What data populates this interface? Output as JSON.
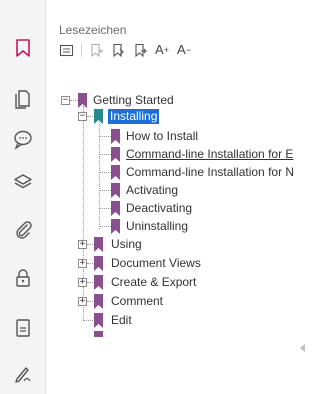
{
  "panel": {
    "title": "Lesezeichen"
  },
  "toolbar": {
    "items": [
      {
        "icon": "options-list-icon"
      },
      {
        "icon": "new-bookmark-icon"
      },
      {
        "icon": "expand-bookmark-icon"
      },
      {
        "icon": "collapse-bookmark-icon"
      }
    ],
    "text_larger": "A",
    "text_larger_sign": "+",
    "text_smaller": "A",
    "text_smaller_sign": "−"
  },
  "rail": {
    "items": [
      {
        "icon": "bookmark-icon",
        "active": true
      },
      {
        "icon": "pages-icon"
      },
      {
        "icon": "comments-icon"
      },
      {
        "icon": "layers-icon"
      },
      {
        "icon": "attachments-icon"
      },
      {
        "icon": "security-lock-icon"
      },
      {
        "icon": "document-icon"
      },
      {
        "icon": "signature-pen-icon"
      }
    ]
  },
  "tree": {
    "root": {
      "label": "Getting Started",
      "expanded": true
    },
    "installing": {
      "label": "Installing",
      "expanded": true,
      "selected": true
    },
    "children": [
      {
        "label": "How to Install"
      },
      {
        "label": "Command-line Installation for E",
        "underlined": true
      },
      {
        "label": "Command-line Installation for N"
      },
      {
        "label": "Activating"
      },
      {
        "label": "Deactivating"
      },
      {
        "label": "Uninstalling"
      }
    ],
    "siblings": [
      {
        "label": "Using",
        "expandable": true
      },
      {
        "label": "Document Views",
        "expandable": true
      },
      {
        "label": "Create & Export",
        "expandable": true
      },
      {
        "label": "Comment",
        "expandable": true
      },
      {
        "label": "Edit",
        "expandable": false
      }
    ]
  },
  "colors": {
    "bookmark_purple": "#8a4f8f",
    "bookmark_teal": "#2a8a8a",
    "rail_active": "#c2185b",
    "selection_blue": "#1a6fd8"
  }
}
